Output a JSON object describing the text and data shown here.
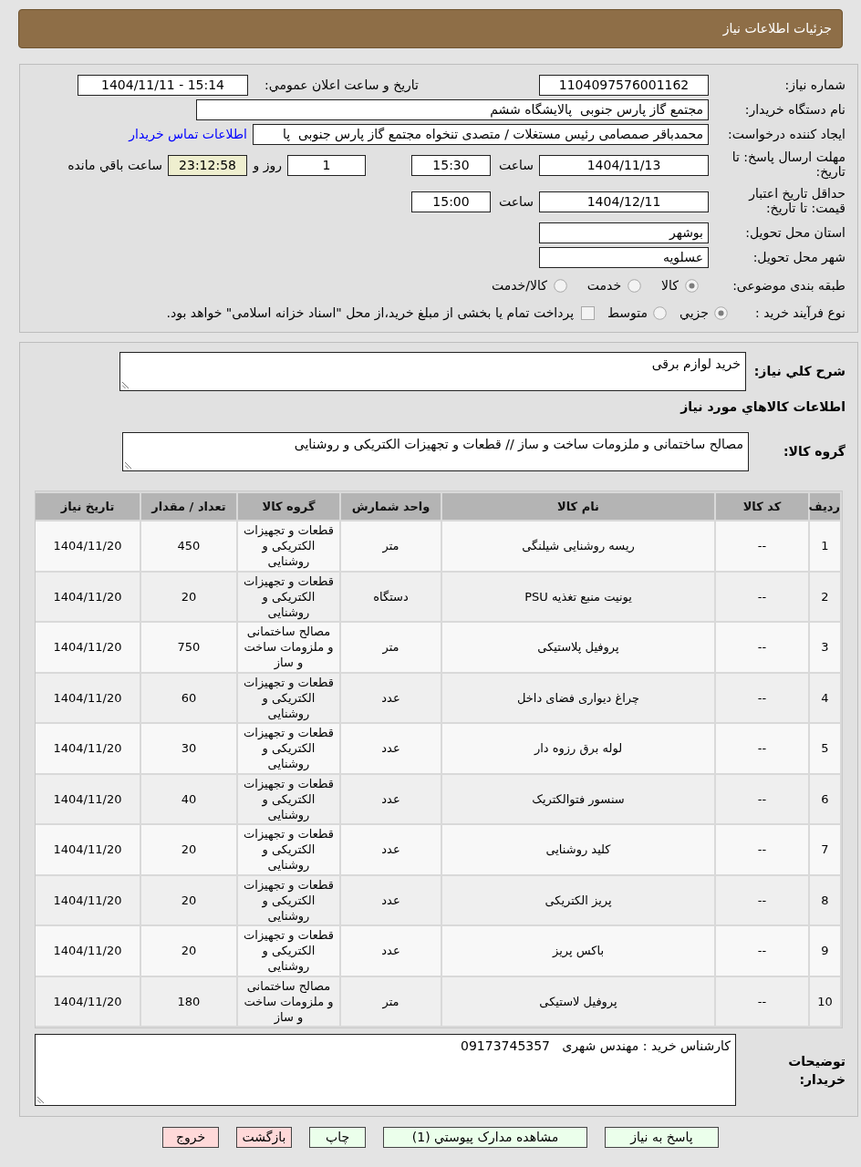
{
  "header": {
    "title": "جزئیات اطلاعات نیاز"
  },
  "details": {
    "need_number": {
      "label": "شماره نیاز:",
      "value": "1104097576001162"
    },
    "announcement": {
      "label": "تاریخ و ساعت اعلان عمومي:",
      "value": "1404/11/11 - 15:14"
    },
    "buyer_org": {
      "label": "نام دستگاه خریدار:",
      "value": "مجتمع گاز پارس جنوبی  پالایشگاه ششم"
    },
    "requester": {
      "label": "ایجاد کننده درخواست:",
      "value": "محمدباقر صمصامی رئیس مستغلات / متصدی تنخواه مجتمع گاز پارس جنوبی  پا",
      "contact_link": "اطلاعات تماس خریدار"
    },
    "response_deadline": {
      "label": "مهلت ارسال پاسخ: تا تاریخ:",
      "date": "1404/11/13",
      "time_label": "ساعت",
      "time": "15:30",
      "days": "1",
      "days_label": "روز و",
      "remaining": "23:12:58",
      "remaining_label": "ساعت باقي مانده"
    },
    "price_validity": {
      "label": "حداقل تاریخ اعتبار قیمت: تا تاریخ:",
      "date": "1404/12/11",
      "time_label": "ساعت",
      "time": "15:00"
    },
    "province": {
      "label": "استان محل تحویل:",
      "value": "بوشهر"
    },
    "city": {
      "label": "شهر محل تحویل:",
      "value": "عسلویه"
    },
    "category": {
      "label": "طبقه بندی موضوعی:",
      "options": [
        {
          "label": "کالا",
          "selected": true
        },
        {
          "label": "خدمت",
          "selected": false
        },
        {
          "label": "کالا/خدمت",
          "selected": false
        }
      ]
    },
    "process": {
      "label": "نوع فرآیند خرید :",
      "options": [
        {
          "label": "جزيي",
          "selected": true
        },
        {
          "label": "متوسط",
          "selected": false
        }
      ],
      "treasury": {
        "label": "پرداخت تمام یا بخشی از مبلغ خرید،از محل \"اسناد خزانه اسلامی\" خواهد بود.",
        "checked": false
      }
    }
  },
  "need": {
    "description": {
      "label": "شرح کلي نیاز:",
      "value": "خرید لوازم برقی"
    },
    "goods_title": "اطلاعات کالاهاي مورد نیاز",
    "goods_group": {
      "label": "گروه کالا:",
      "value": "مصالح ساختمانی و ملزومات ساخت و ساز // قطعات و تجهیزات الکتریکی و روشنایی"
    },
    "table": {
      "columns": [
        "ردیف",
        "کد کالا",
        "نام کالا",
        "واحد شمارش",
        "گروه کالا",
        "تعداد / مقدار",
        "تاریخ نیاز"
      ],
      "rows": [
        {
          "number": "1",
          "code": "--",
          "name": "ریسه روشنایی شیلنگی",
          "unit": "متر",
          "group": "قطعات و تجهیزات الکتریکی و روشنایی",
          "quantity": "450",
          "date": "1404/11/20"
        },
        {
          "number": "2",
          "code": "--",
          "name": "یونیت منبع تغذیه PSU",
          "unit": "دستگاه",
          "group": "قطعات و تجهیزات الکتریکی و روشنایی",
          "quantity": "20",
          "date": "1404/11/20"
        },
        {
          "number": "3",
          "code": "--",
          "name": "پروفیل پلاستیکی",
          "unit": "متر",
          "group": "مصالح ساختمانی و ملزومات ساخت و ساز",
          "quantity": "750",
          "date": "1404/11/20"
        },
        {
          "number": "4",
          "code": "--",
          "name": "چراغ دیواری فضای داخل",
          "unit": "عدد",
          "group": "قطعات و تجهیزات الکتریکی و روشنایی",
          "quantity": "60",
          "date": "1404/11/20"
        },
        {
          "number": "5",
          "code": "--",
          "name": "لوله برق رزوه دار",
          "unit": "عدد",
          "group": "قطعات و تجهیزات الکتریکی و روشنایی",
          "quantity": "30",
          "date": "1404/11/20"
        },
        {
          "number": "6",
          "code": "--",
          "name": "سنسور فتوالکتریک",
          "unit": "عدد",
          "group": "قطعات و تجهیزات الکتریکی و روشنایی",
          "quantity": "40",
          "date": "1404/11/20"
        },
        {
          "number": "7",
          "code": "--",
          "name": "کلید روشنایی",
          "unit": "عدد",
          "group": "قطعات و تجهیزات الکتریکی و روشنایی",
          "quantity": "20",
          "date": "1404/11/20"
        },
        {
          "number": "8",
          "code": "--",
          "name": "پریز الکتریکی",
          "unit": "عدد",
          "group": "قطعات و تجهیزات الکتریکی و روشنایی",
          "quantity": "20",
          "date": "1404/11/20"
        },
        {
          "number": "9",
          "code": "--",
          "name": "باکس پریز",
          "unit": "عدد",
          "group": "قطعات و تجهیزات الکتریکی و روشنایی",
          "quantity": "20",
          "date": "1404/11/20"
        },
        {
          "number": "10",
          "code": "--",
          "name": "پروفیل لاستیکی",
          "unit": "متر",
          "group": "مصالح ساختمانی و ملزومات ساخت و ساز",
          "quantity": "180",
          "date": "1404/11/20"
        }
      ]
    },
    "buyer_notes": {
      "label": "توضیحات خریدار:",
      "value": "کارشناس خرید : مهندس شهری   09173745357"
    }
  },
  "buttons": [
    {
      "label": "پاسخ به نیاز",
      "kind": "action"
    },
    {
      "label": "مشاهده مدارک پیوستي (1)",
      "kind": "action"
    },
    {
      "label": "چاپ",
      "kind": "action"
    },
    {
      "label": "بازگشت",
      "kind": "exit"
    },
    {
      "label": "خروج",
      "kind": "exit"
    }
  ]
}
